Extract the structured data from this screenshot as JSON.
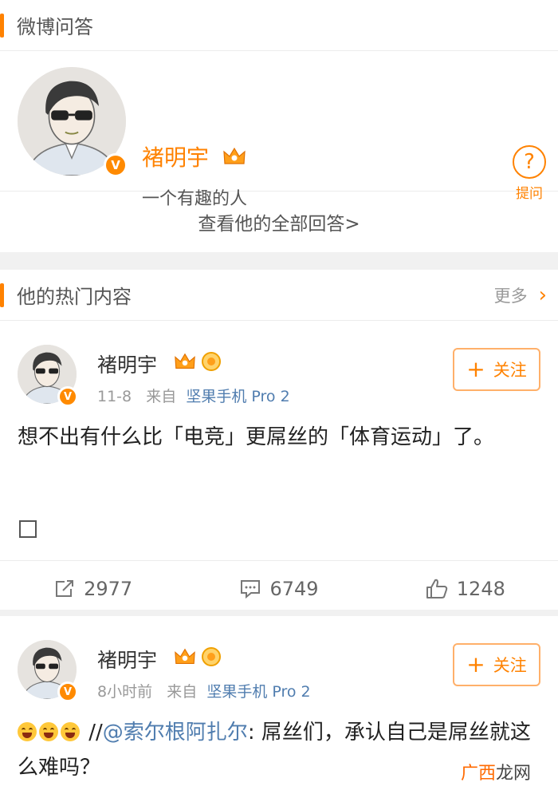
{
  "qa_section": {
    "title": "微博问答",
    "user": {
      "name": "褚明宇",
      "description": "一个有趣的人"
    },
    "ask_label": "提问",
    "view_all": "查看他的全部回答>"
  },
  "hot_section": {
    "title": "他的热门内容",
    "more_label": "更多",
    "more_icon": "chevron-right-icon"
  },
  "posts": [
    {
      "author": "褚明宇",
      "time": "11-8",
      "source_prefix": "来自",
      "source": "坚果手机 Pro 2",
      "follow_label": "关注",
      "text": "想不出有什么比「电竞」更屌丝的「体育运动」了。",
      "repost_count": "2977",
      "comment_count": "6749",
      "like_count": "1248"
    },
    {
      "author": "褚明宇",
      "time": "8小时前",
      "source_prefix": "来自",
      "source": "坚果手机 Pro 2",
      "follow_label": "关注",
      "text_prefix": "//",
      "mention": "@索尔根阿扎尔",
      "text_rest": ": 屌丝们，承认自己是屌丝就这么难吗？"
    }
  ],
  "watermark": {
    "part1": "广西",
    "part2": "龙网"
  },
  "colors": {
    "accent": "#ff8200",
    "link": "#507daf"
  }
}
